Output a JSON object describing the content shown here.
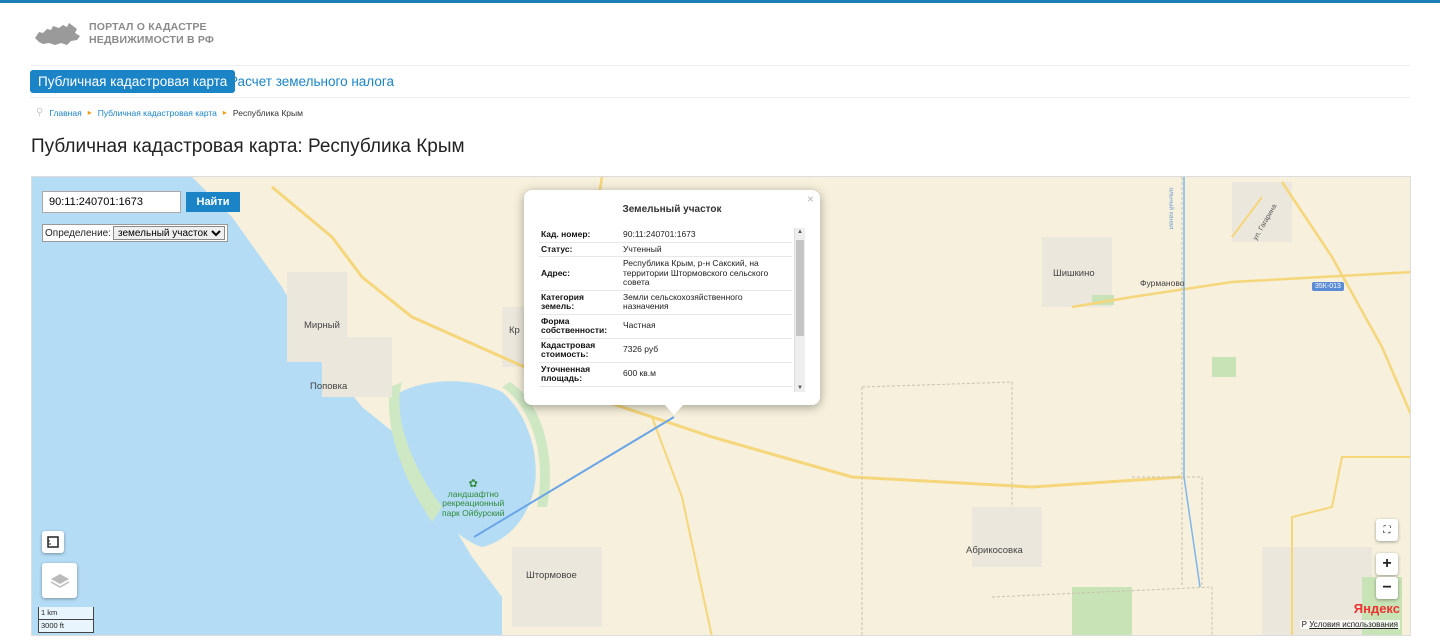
{
  "header": {
    "logo_line1": "ПОРТАЛ О КАДАСТРЕ",
    "logo_line2": "НЕДВИЖИМОСТИ В РФ"
  },
  "nav": {
    "tabs": [
      {
        "label": "Публичная кадастровая карта",
        "active": true
      },
      {
        "label": "Расчет земельного налога",
        "active": false
      }
    ]
  },
  "breadcrumb": {
    "items": [
      "Главная",
      "Публичная кадастровая карта",
      "Республика Крым"
    ]
  },
  "page": {
    "title": "Публичная кадастровая карта: Республика Крым"
  },
  "map": {
    "search": {
      "value": "90:11:240701:1673",
      "button": "Найти"
    },
    "definition": {
      "label": "Определение:",
      "selected": "земельный участок"
    },
    "labels": {
      "mirny": "Мирный",
      "popovka": "Поповка",
      "kr": "Кр",
      "shishkino": "Шишкино",
      "furmanovo": "Фурманово",
      "abrikosovka": "Абрикосовка",
      "shtormovoe": "Штормовое",
      "park": [
        "ландшафтно",
        "рекреационный",
        "парк Ойбурский"
      ],
      "road": "35К-013",
      "street": "ул. Гагарина",
      "canal": "ольный канал"
    },
    "scale": {
      "km": "1 km",
      "ft": "3000 ft"
    },
    "attribution": {
      "brand": "Яндекс",
      "terms": "Условия использования",
      "prefix": "Р"
    },
    "zoom_in": "+",
    "zoom_out": "−"
  },
  "popup": {
    "title": "Земельный участок",
    "close": "×",
    "rows": [
      {
        "key": "Кад. номер:",
        "value": "90:11:240701:1673"
      },
      {
        "key": "Статус:",
        "value": "Учтенный"
      },
      {
        "key": "Адрес:",
        "value": "Республика Крым, р-н Сакский, на территории Штормовского сельского совета"
      },
      {
        "key": "Категория земель:",
        "value": "Земли сельскохозяйственного назначения"
      },
      {
        "key": "Форма собственности:",
        "value": "Частная"
      },
      {
        "key": "Кадастровая стоимость:",
        "value": "7326 руб"
      },
      {
        "key": "Уточненная площадь:",
        "value": "600 кв.м"
      }
    ]
  },
  "colors": {
    "accent": "#1a84c7",
    "sea": "#b5dcf5",
    "land": "#f6f0dc",
    "road": "#f6d67a",
    "yandex": "#e33333"
  }
}
